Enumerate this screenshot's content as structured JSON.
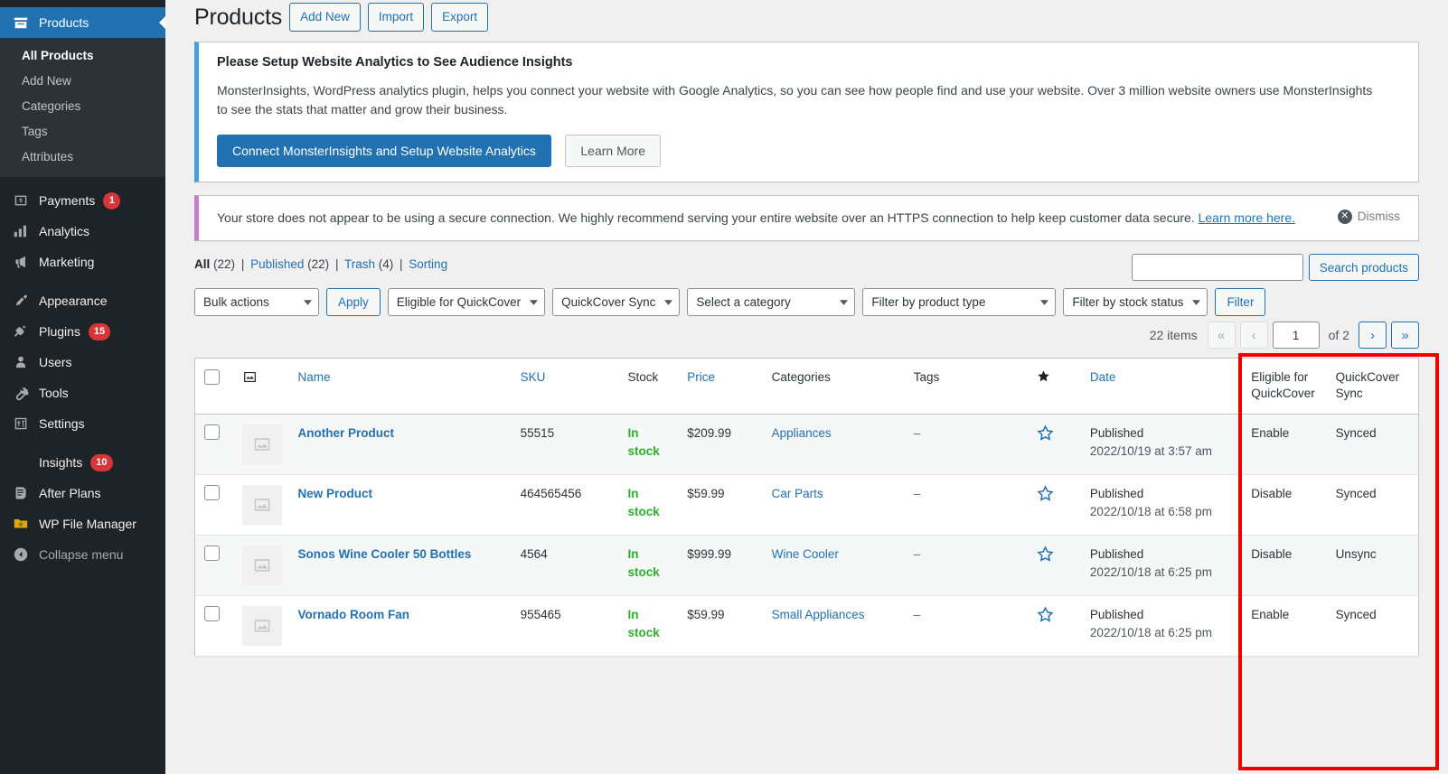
{
  "sidebar": {
    "current_menu": "Products",
    "items": [
      {
        "label": "Products",
        "icon": "products-icon",
        "current": true,
        "submenu": [
          {
            "label": "All Products",
            "current": true
          },
          {
            "label": "Add New",
            "current": false
          },
          {
            "label": "Categories",
            "current": false
          },
          {
            "label": "Tags",
            "current": false
          },
          {
            "label": "Attributes",
            "current": false
          }
        ]
      },
      {
        "label": "Payments",
        "icon": "payments-icon",
        "badge": "1"
      },
      {
        "label": "Analytics",
        "icon": "analytics-icon",
        "badge": ""
      },
      {
        "label": "Marketing",
        "icon": "marketing-icon",
        "badge": ""
      },
      {
        "label": "Appearance",
        "icon": "appearance-icon",
        "badge": "",
        "gap_before": true
      },
      {
        "label": "Plugins",
        "icon": "plugins-icon",
        "badge": "15"
      },
      {
        "label": "Users",
        "icon": "users-icon",
        "badge": ""
      },
      {
        "label": "Tools",
        "icon": "tools-icon",
        "badge": ""
      },
      {
        "label": "Settings",
        "icon": "settings-icon",
        "badge": ""
      },
      {
        "label": "Insights",
        "icon": "insights-icon",
        "badge": "10",
        "gap_before": true
      },
      {
        "label": "After Plans",
        "icon": "after-plans-icon",
        "badge": ""
      },
      {
        "label": "WP File Manager",
        "icon": "wp-file-manager-icon",
        "badge": ""
      },
      {
        "label": "Collapse menu",
        "icon": "collapse-icon",
        "badge": "",
        "gap_before": false
      }
    ]
  },
  "header": {
    "title": "Products",
    "add_new_label": "Add New",
    "import_label": "Import",
    "export_label": "Export"
  },
  "notice_monsterinsights": {
    "heading": "Please Setup Website Analytics to See Audience Insights",
    "body": "MonsterInsights, WordPress analytics plugin, helps you connect your website with Google Analytics, so you can see how people find and use your website. Over 3 million website owners use MonsterInsights to see the stats that matter and grow their business.",
    "primary_button": "Connect MonsterInsights and Setup Website Analytics",
    "secondary_button": "Learn More",
    "accent_color": "#4a9ede"
  },
  "notice_https": {
    "body_part1": "Your store does not appear to be using a secure connection. We highly recommend serving your entire website over an HTTPS connection to help keep customer data secure. ",
    "link_text": "Learn more here.",
    "dismiss_label": "Dismiss",
    "accent_color": "#c77fc4"
  },
  "status_links": {
    "all_label": "All",
    "all_count": "(22)",
    "published_label": "Published",
    "published_count": "(22)",
    "trash_label": "Trash",
    "trash_count": "(4)",
    "sorting_label": "Sorting",
    "separator": "|"
  },
  "search": {
    "value": "",
    "placeholder": "",
    "button_label": "Search products"
  },
  "tablenav": {
    "bulk_actions": "Bulk actions",
    "apply_label": "Apply",
    "eligible_quickcover": "Eligible for QuickCover",
    "quickcover_sync": "QuickCover Sync",
    "select_category": "Select a category",
    "filter_product_type": "Filter by product type",
    "filter_stock_status": "Filter by stock status",
    "filter_label": "Filter"
  },
  "pagination": {
    "items_label": "22 items",
    "first_label": "«",
    "prev_label": "‹",
    "current_page": "1",
    "of_label": "of 2",
    "next_label": "›",
    "last_label": "»"
  },
  "table": {
    "columns": {
      "image": "image-icon",
      "name": "Name",
      "sku": "SKU",
      "stock": "Stock",
      "price": "Price",
      "categories": "Categories",
      "tags": "Tags",
      "featured": "star-icon",
      "date": "Date",
      "eligible_quickcover": "Eligible for QuickCover",
      "quickcover_sync": "QuickCover Sync"
    },
    "rows": [
      {
        "name": "Another Product",
        "sku": "55515",
        "stock": "In stock",
        "price": "$209.99",
        "categories": "Appliances",
        "tags": "–",
        "date_status": "Published",
        "date_value": "2022/10/19 at 3:57 am",
        "eligible": "Enable",
        "sync": "Synced"
      },
      {
        "name": "New Product",
        "sku": "464565456",
        "stock": "In stock",
        "price": "$59.99",
        "categories": "Car Parts",
        "tags": "–",
        "date_status": "Published",
        "date_value": "2022/10/18 at 6:58 pm",
        "eligible": "Disable",
        "sync": "Synced"
      },
      {
        "name": "Sonos Wine Cooler 50 Bottles",
        "sku": "4564",
        "stock": "In stock",
        "price": "$999.99",
        "categories": "Wine Cooler",
        "tags": "–",
        "date_status": "Published",
        "date_value": "2022/10/18 at 6:25 pm",
        "eligible": "Disable",
        "sync": "Unsync"
      },
      {
        "name": "Vornado Room Fan",
        "sku": "955465",
        "stock": "In stock",
        "price": "$59.99",
        "categories": "Small Appliances",
        "tags": "–",
        "date_status": "Published",
        "date_value": "2022/10/18 at 6:25 pm",
        "eligible": "Enable",
        "sync": "Synced"
      }
    ]
  },
  "annotation": {
    "highlight_color": "#ee0000"
  }
}
